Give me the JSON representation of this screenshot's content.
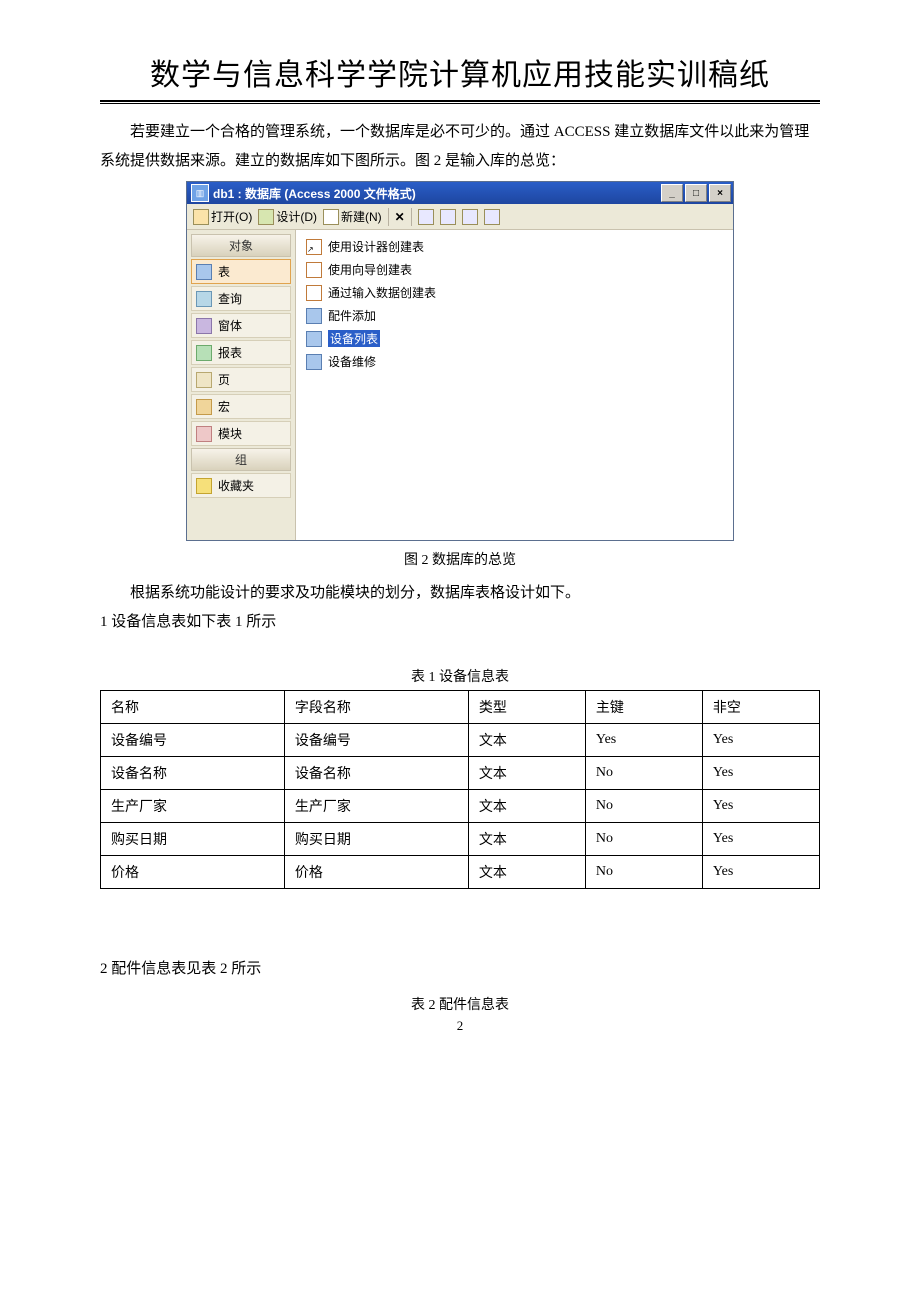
{
  "doc": {
    "title": "数学与信息科学学院计算机应用技能实训稿纸",
    "para1": "若要建立一个合格的管理系统，一个数据库是必不可少的。通过 ACCESS 建立数据库文件以此来为管理系统提供数据来源。建立的数据库如下图所示。图 2 是输入库的总览：",
    "fig2_caption": "图 2 数据库的总览",
    "para2": "根据系统功能设计的要求及功能模块的划分，数据库表格设计如下。",
    "para3": "1 设备信息表如下表 1 所示",
    "table1_caption": "表 1  设备信息表",
    "para4": "2  配件信息表见表 2 所示",
    "table2_caption": "表 2  配件信息表",
    "page_number": "2"
  },
  "access": {
    "titlebar": "db1 : 数据库 (Access 2000 文件格式)",
    "btn_open": "打开(O)",
    "btn_design": "设计(D)",
    "btn_new": "新建(N)",
    "groups_header": "对象",
    "group2_header": "组",
    "objects": [
      {
        "label": "表",
        "selected": true
      },
      {
        "label": "查询"
      },
      {
        "label": "窗体"
      },
      {
        "label": "报表"
      },
      {
        "label": "页"
      },
      {
        "label": "宏"
      },
      {
        "label": "模块"
      }
    ],
    "favorites": "收藏夹",
    "list": [
      {
        "label": "使用设计器创建表",
        "shortcut": true
      },
      {
        "label": "使用向导创建表",
        "shortcut": true
      },
      {
        "label": "通过输入数据创建表",
        "shortcut": true
      },
      {
        "label": "配件添加"
      },
      {
        "label": "设备列表",
        "selected": true
      },
      {
        "label": "设备维修"
      }
    ]
  },
  "table1": {
    "headers": [
      "名称",
      "字段名称",
      "类型",
      "主键",
      "非空"
    ],
    "rows": [
      [
        "设备编号",
        "设备编号",
        "文本",
        "Yes",
        "Yes"
      ],
      [
        "设备名称",
        "设备名称",
        "文本",
        "No",
        "Yes"
      ],
      [
        "生产厂家",
        "生产厂家",
        "文本",
        "No",
        "Yes"
      ],
      [
        "购买日期",
        "购买日期",
        "文本",
        "No",
        "Yes"
      ],
      [
        "价格",
        "价格",
        "文本",
        "No",
        "Yes"
      ]
    ]
  }
}
